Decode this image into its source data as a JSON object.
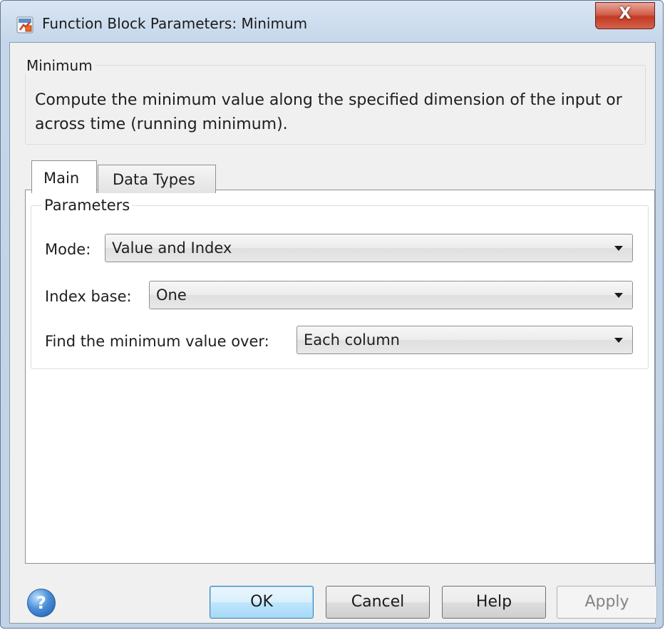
{
  "window": {
    "title": "Function Block Parameters: Minimum",
    "close_label": "X"
  },
  "description": {
    "group_title": "Minimum",
    "text": "Compute the minimum value along the specified dimension of the input or across time (running minimum)."
  },
  "tabs": [
    {
      "label": "Main",
      "selected": true
    },
    {
      "label": "Data Types",
      "selected": false
    }
  ],
  "parameters": {
    "group_title": "Parameters",
    "mode": {
      "label": "Mode:",
      "value": "Value and Index"
    },
    "index_base": {
      "label": "Index base:",
      "value": "One"
    },
    "find_over": {
      "label": "Find the minimum value over:",
      "value": "Each column"
    }
  },
  "buttons": {
    "help_icon_glyph": "?",
    "ok": "OK",
    "cancel": "Cancel",
    "help": "Help",
    "apply": "Apply"
  },
  "colors": {
    "title_bar": "#c4d6ea",
    "close_button": "#c23a23",
    "default_button_border": "#3c7fb1",
    "panel_background": "#f0f0f0"
  }
}
